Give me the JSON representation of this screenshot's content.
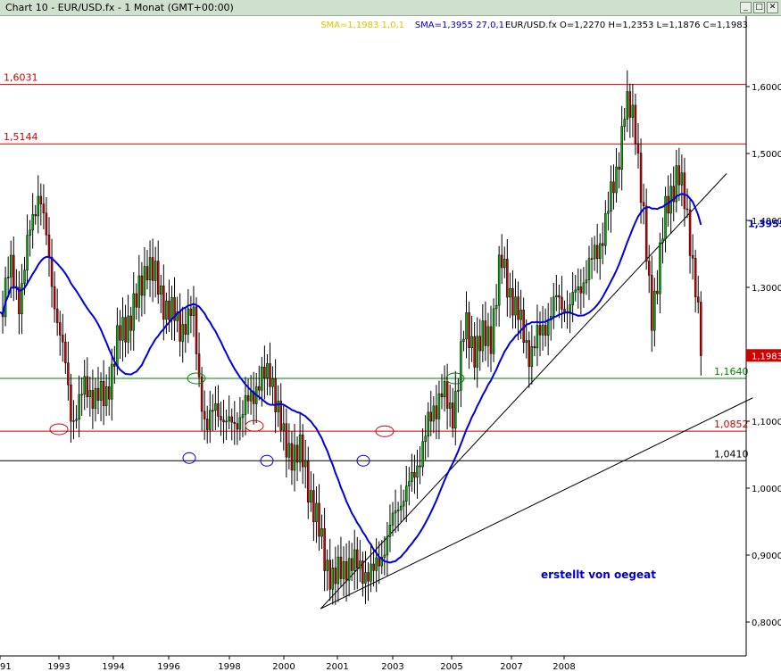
{
  "window": {
    "title": "Chart 10 - EUR/USD.fx - 1 Monat (GMT+00:00)",
    "buttons": [
      "_",
      "□",
      "✕"
    ]
  },
  "header": {
    "sma1": "SMA=1,1983  1,0,1",
    "sma2": "SMA=1,3955  27,0,1",
    "ohlc": "EUR/USD.fx  O=1,2270 H=1,2353 L=1,1876 C=1,1983"
  },
  "watermark": "erstellt von oegeat",
  "colors": {
    "up": "#00b000",
    "down": "#d00000",
    "sma": "#0000e0",
    "resistance": "#d00000",
    "support_green": "#008000",
    "support_black": "#000000",
    "header_sma1": "#e0c000",
    "header_sma2": "#0000c0",
    "price_box": "#d00000"
  },
  "chart_data": {
    "type": "candlestick",
    "symbol": "EUR/USD.fx",
    "timeframe": "1 Monat",
    "y_axis": {
      "min": 0.77,
      "max": 1.66,
      "ticks": [
        {
          "value": 1.6,
          "label": "1,6000"
        },
        {
          "value": 1.5,
          "label": "1,5000"
        },
        {
          "value": 1.4,
          "label": "1,4000"
        },
        {
          "value": 1.3,
          "label": "1,3000"
        },
        {
          "value": 1.2,
          "label": "1,2000"
        },
        {
          "value": 1.1,
          "label": "1,1000"
        },
        {
          "value": 1.0,
          "label": "1,0000"
        },
        {
          "value": 0.9,
          "label": "0,9000"
        },
        {
          "value": 0.8,
          "label": "0,8000"
        }
      ]
    },
    "x_axis": {
      "min": 1991.0,
      "max": 2009.25,
      "labels": [
        {
          "year": 1991.0,
          "label": "91"
        },
        {
          "year": 1993.0,
          "label": "1993"
        },
        {
          "year": 1994.9,
          "label": "1994"
        },
        {
          "year": 1996.8,
          "label": "1996"
        },
        {
          "year": 1999.0,
          "label": "1998"
        },
        {
          "year": 2001.0,
          "label": "2000"
        },
        {
          "year": 2003.0,
          "label": "2001"
        },
        {
          "year": 2004.9,
          "label": "2003"
        },
        {
          "year": 2006.9,
          "label": "2005"
        },
        {
          "year": 2009.0,
          "label": "2007"
        },
        {
          "year": 2010.9,
          "label": "2008"
        }
      ]
    },
    "horizontal_levels": [
      {
        "value": 1.6031,
        "label": "1,6031",
        "color": "#d00000",
        "label_side": "left"
      },
      {
        "value": 1.5144,
        "label": "1,5144",
        "color": "#d00000",
        "label_side": "left"
      },
      {
        "value": 1.164,
        "label": "1,1640",
        "color": "#008000",
        "label_side": "right"
      },
      {
        "value": 1.0852,
        "label": "1,0852",
        "color": "#d00000",
        "label_side": "right"
      },
      {
        "value": 1.041,
        "label": "1,0410",
        "color": "#000000",
        "label_side": "right"
      }
    ],
    "trendlines": [
      {
        "from": [
          2000.8,
          0.82
        ],
        "to": [
          2013.2,
          1.47
        ]
      },
      {
        "from": [
          2000.8,
          0.82
        ],
        "to": [
          2014.0,
          1.135
        ]
      }
    ],
    "right_labels": [
      {
        "value": 1.3955,
        "label": "1,3955",
        "color": "#0000c0",
        "boxed": false
      },
      {
        "value": 1.1983,
        "label": "1,1983",
        "color": "#d00000",
        "boxed": true
      }
    ],
    "circles": [
      {
        "x": 1993.1,
        "y": 1.088,
        "color": "#d00000"
      },
      {
        "x": 1997.2,
        "y": 1.045,
        "color": "#0000e0"
      },
      {
        "x": 1997.4,
        "y": 1.164,
        "color": "#008000"
      },
      {
        "x": 1999.8,
        "y": 1.093,
        "color": "#d00000"
      },
      {
        "x": 2000.3,
        "y": 1.041,
        "color": "#0000e0"
      },
      {
        "x": 2004.0,
        "y": 1.041,
        "color": "#0000e0"
      },
      {
        "x": 2004.9,
        "y": 1.085,
        "color": "#d00000"
      },
      {
        "x": 2007.2,
        "y": 1.164,
        "color": "#008000"
      }
    ],
    "anchors": [
      {
        "t": 1991.0,
        "p": 1.26
      },
      {
        "t": 1991.3,
        "p": 1.33
      },
      {
        "t": 1991.6,
        "p": 1.28
      },
      {
        "t": 1991.9,
        "p": 1.38
      },
      {
        "t": 1992.2,
        "p": 1.45
      },
      {
        "t": 1992.6,
        "p": 1.3
      },
      {
        "t": 1993.0,
        "p": 1.18
      },
      {
        "t": 1993.2,
        "p": 1.1
      },
      {
        "t": 1993.6,
        "p": 1.15
      },
      {
        "t": 1994.2,
        "p": 1.13
      },
      {
        "t": 1994.6,
        "p": 1.22
      },
      {
        "t": 1995.2,
        "p": 1.28
      },
      {
        "t": 1995.5,
        "p": 1.34
      },
      {
        "t": 1996.0,
        "p": 1.28
      },
      {
        "t": 1996.5,
        "p": 1.24
      },
      {
        "t": 1996.9,
        "p": 1.26
      },
      {
        "t": 1997.1,
        "p": 1.16
      },
      {
        "t": 1997.3,
        "p": 1.08
      },
      {
        "t": 1997.6,
        "p": 1.13
      },
      {
        "t": 1997.9,
        "p": 1.09
      },
      {
        "t": 1998.4,
        "p": 1.11
      },
      {
        "t": 1998.9,
        "p": 1.16
      },
      {
        "t": 1999.3,
        "p": 1.17
      },
      {
        "t": 1999.7,
        "p": 1.06
      },
      {
        "t": 2000.2,
        "p": 1.05
      },
      {
        "t": 2000.5,
        "p": 0.99
      },
      {
        "t": 2000.9,
        "p": 0.9
      },
      {
        "t": 2001.2,
        "p": 0.86
      },
      {
        "t": 2001.6,
        "p": 0.89
      },
      {
        "t": 2002.0,
        "p": 0.88
      },
      {
        "t": 2002.4,
        "p": 0.87
      },
      {
        "t": 2002.8,
        "p": 0.92
      },
      {
        "t": 2003.2,
        "p": 0.98
      },
      {
        "t": 2003.6,
        "p": 1.01
      },
      {
        "t": 2004.0,
        "p": 1.08
      },
      {
        "t": 2004.5,
        "p": 1.15
      },
      {
        "t": 2004.8,
        "p": 1.1
      },
      {
        "t": 2005.2,
        "p": 1.24
      },
      {
        "t": 2005.5,
        "p": 1.21
      },
      {
        "t": 2006.0,
        "p": 1.23
      },
      {
        "t": 2006.3,
        "p": 1.34
      },
      {
        "t": 2006.8,
        "p": 1.26
      },
      {
        "t": 2007.2,
        "p": 1.2
      },
      {
        "t": 2007.6,
        "p": 1.24
      },
      {
        "t": 2008.0,
        "p": 1.28
      },
      {
        "t": 2008.4,
        "p": 1.27
      },
      {
        "t": 2008.8,
        "p": 1.31
      },
      {
        "t": 2009.3,
        "p": 1.36
      },
      {
        "t": 2009.8,
        "p": 1.46
      },
      {
        "t": 2010.1,
        "p": 1.57
      },
      {
        "t": 2010.4,
        "p": 1.55
      },
      {
        "t": 2010.6,
        "p": 1.44
      },
      {
        "t": 2010.9,
        "p": 1.25
      },
      {
        "t": 2011.3,
        "p": 1.4
      },
      {
        "t": 2011.7,
        "p": 1.48
      },
      {
        "t": 2012.0,
        "p": 1.4
      },
      {
        "t": 2012.2,
        "p": 1.33
      },
      {
        "t": 2012.45,
        "p": 1.198
      }
    ]
  }
}
